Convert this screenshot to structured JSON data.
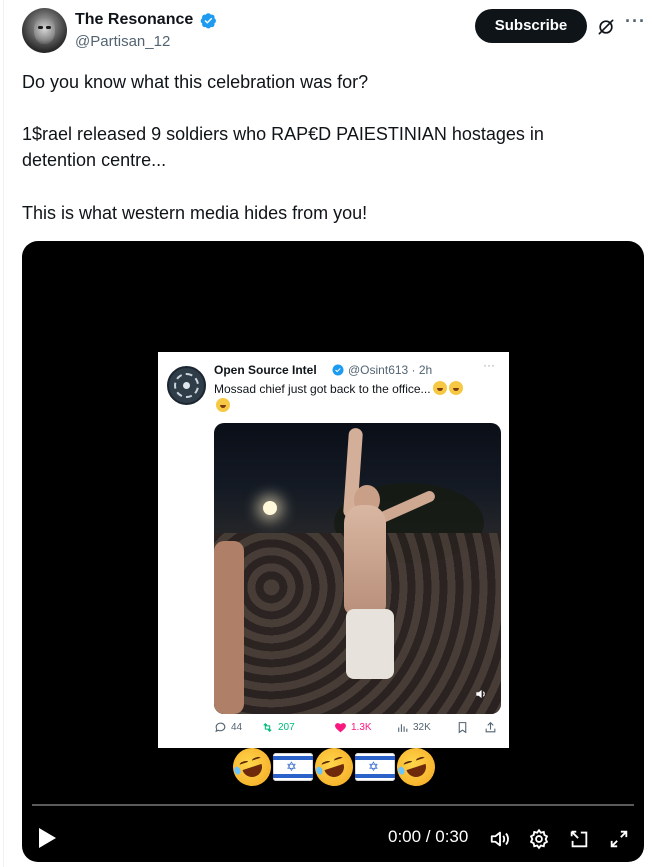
{
  "author": {
    "name": "The Resonance",
    "handle": "@Partisan_12",
    "verified": true,
    "subscribe_label": "Subscribe",
    "more_label": "···"
  },
  "tweet": {
    "line1": "Do you know what this celebration was for?",
    "line2": "1$rael released 9 soldiers who RAP€D PAIESTINIAN hostages in",
    "line3": "detention centre...",
    "line4": "This is what western media hides from you!"
  },
  "embedded_post": {
    "name": "Open Source Intel",
    "handle_time": "@Osint613 · 2h",
    "more_label": "···",
    "text": "Mossad chief just got back to the office...",
    "stats": {
      "replies": "44",
      "reposts": "207",
      "likes": "1.3K",
      "views": "32K"
    }
  },
  "overlay_emojis": [
    "rolling-on-floor-laughing",
    "flag-israel",
    "rolling-on-floor-laughing",
    "flag-israel",
    "rolling-on-floor-laughing"
  ],
  "video": {
    "time": "0:00 / 0:30",
    "progress": 0.0
  },
  "colors": {
    "subscribe_bg": "#0f1419",
    "verified_blue": "#1d9bf0",
    "repost_green": "#00ba7c",
    "like_pink": "#f91880",
    "secondary_text": "#536471"
  }
}
